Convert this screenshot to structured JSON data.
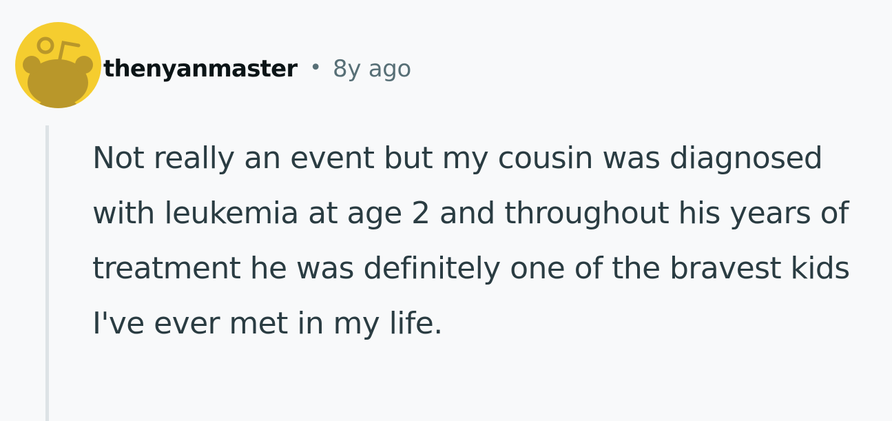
{
  "comment": {
    "username": "thenyanmaster",
    "separator": "•",
    "timestamp": "8y ago",
    "body": "Not really an event but my cousin was diagnosed with leukemia at age 2 and throughout his years of treatment he was definitely one of the bravest kids I've ever met in my life."
  },
  "avatar": {
    "icon": "reddit-snoo-avatar-icon",
    "background_color": "#f5cd2f",
    "figure_color": "#b9972a"
  },
  "colors": {
    "page_background": "#f8f9fa",
    "username": "#0b1416",
    "meta_text": "#576f76",
    "body_text": "#2a3c42",
    "thread_line": "#dde3e6"
  }
}
